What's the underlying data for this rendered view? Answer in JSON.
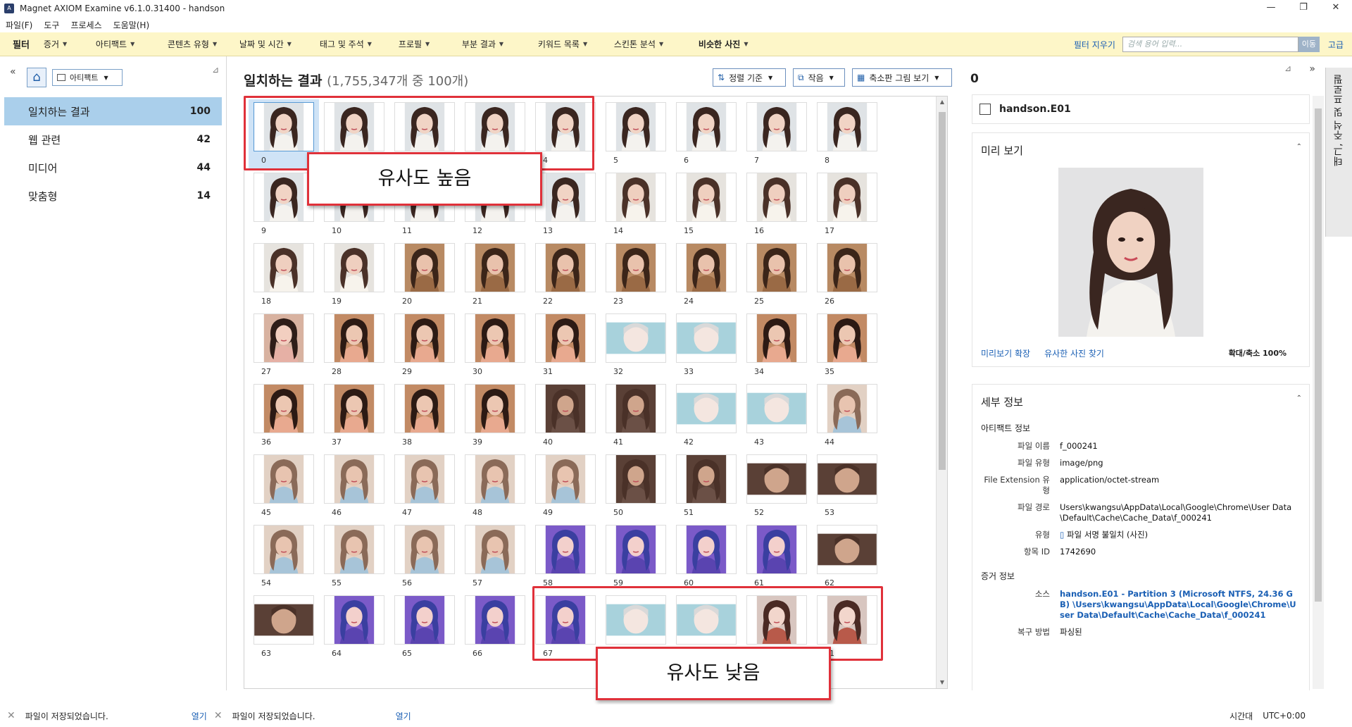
{
  "window": {
    "title": "Magnet AXIOM Examine v6.1.0.31400 - handson",
    "minimize": "—",
    "restore": "❐",
    "close": "✕"
  },
  "menu": [
    "파일(F)",
    "도구",
    "프로세스",
    "도움말(H)"
  ],
  "filter_bar": {
    "label": "필터",
    "items": [
      "증거",
      "아티팩트",
      "콘텐츠 유형",
      "날짜 및 시간",
      "태그 및 주석",
      "프로필",
      "부분 결과",
      "키워드 목록",
      "스킨톤 분석",
      "비슷한 사진"
    ],
    "clear": "필터 지우기",
    "search_placeholder": "검색 용어 입력...",
    "go": "이동",
    "advanced": "고급"
  },
  "left_panel": {
    "dropdown": "아티팩트",
    "categories": [
      {
        "label": "일치하는 결과",
        "count": "100"
      },
      {
        "label": "웹 관련",
        "count": "42"
      },
      {
        "label": "미디어",
        "count": "44"
      },
      {
        "label": "맞춤형",
        "count": "14"
      }
    ]
  },
  "center": {
    "title": "일치하는 결과",
    "subtitle": "(1,755,347개 중 100개)",
    "sort": "정렬 기준",
    "size": "작음",
    "view": "축소판 그림 보기",
    "thumbs": [
      "0",
      "1",
      "2",
      "3",
      "4",
      "5",
      "6",
      "7",
      "8",
      "9",
      "10",
      "11",
      "12",
      "13",
      "14",
      "15",
      "16",
      "17",
      "18",
      "19",
      "20",
      "21",
      "22",
      "23",
      "24",
      "25",
      "26",
      "27",
      "28",
      "29",
      "30",
      "31",
      "32",
      "33",
      "34",
      "35",
      "36",
      "37",
      "38",
      "39",
      "40",
      "41",
      "42",
      "43",
      "44",
      "45",
      "46",
      "47",
      "48",
      "49",
      "50",
      "51",
      "52",
      "53",
      "54",
      "55",
      "56",
      "57",
      "58",
      "59",
      "60",
      "61",
      "62",
      "63",
      "64",
      "65",
      "66",
      "67",
      "68",
      "69",
      "70",
      "71"
    ],
    "callout_high": "유사도 높음",
    "callout_low": "유사도 낮음"
  },
  "right_panel": {
    "title": "0",
    "side_tab": "태그, 주석 및 프로필",
    "file": "handson.E01",
    "preview_title": "미리 보기",
    "preview_expand": "미리보기 확장",
    "find_similar": "유사한 사진 찾기",
    "zoom": "확대/축소 100%",
    "details_title": "세부 정보",
    "artifact_info": "아티팩트 정보",
    "fields": [
      {
        "k": "파일 이름",
        "v": "f_000241"
      },
      {
        "k": "파일 유형",
        "v": "image/png"
      },
      {
        "k": "File Extension 유형",
        "v": "application/octet-stream"
      },
      {
        "k": "파일 경로",
        "v": "Users\\kwangsu\\AppData\\Local\\Google\\Chrome\\User Data\\Default\\Cache\\Cache_Data\\f_000241"
      },
      {
        "k": "유형",
        "v": "파일 서명 불일치 (사진)"
      },
      {
        "k": "항목 ID",
        "v": "1742690"
      }
    ],
    "evidence_info": "증거 정보",
    "source_key": "소스",
    "source_val": "handson.E01 - Partition 3 (Microsoft NTFS, 24.36 GB) \\Users\\kwangsu\\AppData\\Local\\Google\\Chrome\\User Data\\Default\\Cache\\Cache_Data\\f_000241",
    "recovery_key": "복구 방법",
    "recovery_val": "파싱된"
  },
  "status": {
    "msg1": "파일이 저장되었습니다.",
    "open1": "열기",
    "msg2": "파일이 저장되었습니다.",
    "open2": "열기",
    "tz_label": "시간대",
    "tz_val": "UTC+0:00"
  },
  "colors": {
    "accent": "#1a5fb4",
    "filter_bg": "#fdf6c8",
    "selection": "#aacfeb",
    "callout": "#e0313a"
  }
}
